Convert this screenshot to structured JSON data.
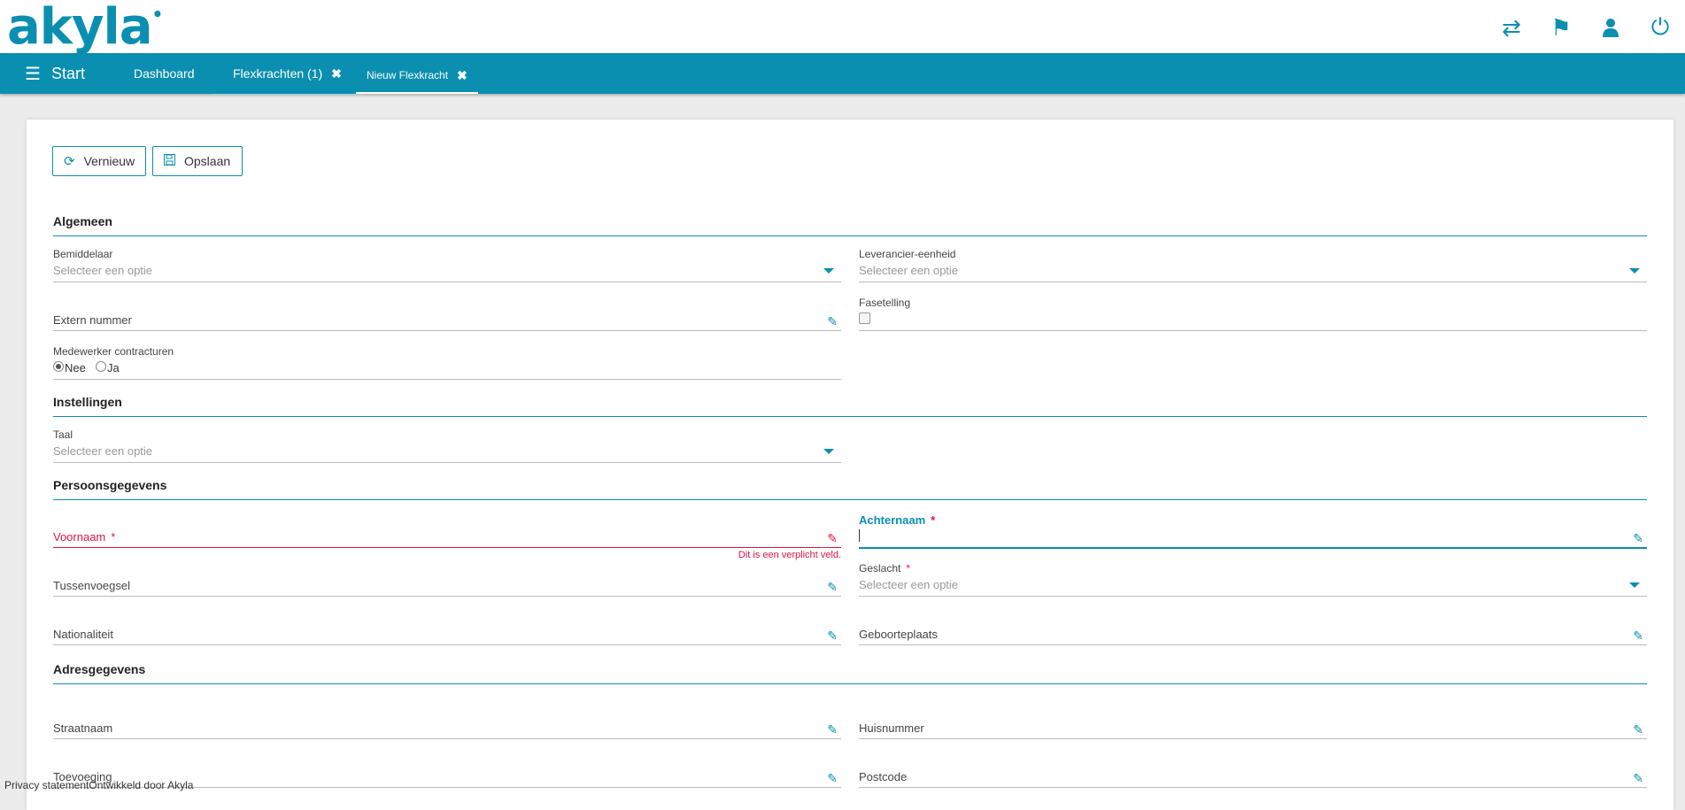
{
  "brand": {
    "logo_text": "akyla",
    "accent_color": "#0a8fb0",
    "error_color": "#e0143c"
  },
  "top_icons": [
    "swap-icon",
    "flag-icon",
    "user-icon",
    "power-icon"
  ],
  "nav": {
    "start_label": "Start",
    "tabs": [
      {
        "label": "Dashboard"
      },
      {
        "label": "Flexkrachten (1)",
        "closable": true
      },
      {
        "label": "Nieuw Flexkracht",
        "closable": true,
        "active": true
      }
    ]
  },
  "toolbar": {
    "refresh_label": "Vernieuw",
    "save_label": "Opslaan"
  },
  "sections": {
    "algemeen": "Algemeen",
    "instellingen": "Instellingen",
    "persoonsgegevens": "Persoonsgegevens",
    "adresgegevens": "Adresgegevens"
  },
  "placeholder": "Selecteer een optie",
  "fields": {
    "bemiddelaar": "Bemiddelaar",
    "leverancier_eenheid": "Leverancier-eenheid",
    "extern_nummer": "Extern nummer",
    "fasetelling": "Fasetelling",
    "medewerker_contracturen": "Medewerker contracturen",
    "radio_nee": "Nee",
    "radio_ja": "Ja",
    "taal": "Taal",
    "voornaam": "Voornaam",
    "achternaam": "Achternaam",
    "required_mark": "*",
    "voornaam_error": "Dit is een verplicht veld.",
    "tussenvoegsel": "Tussenvoegsel",
    "geslacht": "Geslacht",
    "nationaliteit": "Nationaliteit",
    "geboorteplaats": "Geboorteplaats",
    "straatnaam": "Straatnaam",
    "huisnummer": "Huisnummer",
    "toevoeging": "Toevoeging",
    "postcode": "Postcode"
  },
  "footer": {
    "privacy": "Privacy statement",
    "credit": "Ontwikkeld door Akyla"
  }
}
